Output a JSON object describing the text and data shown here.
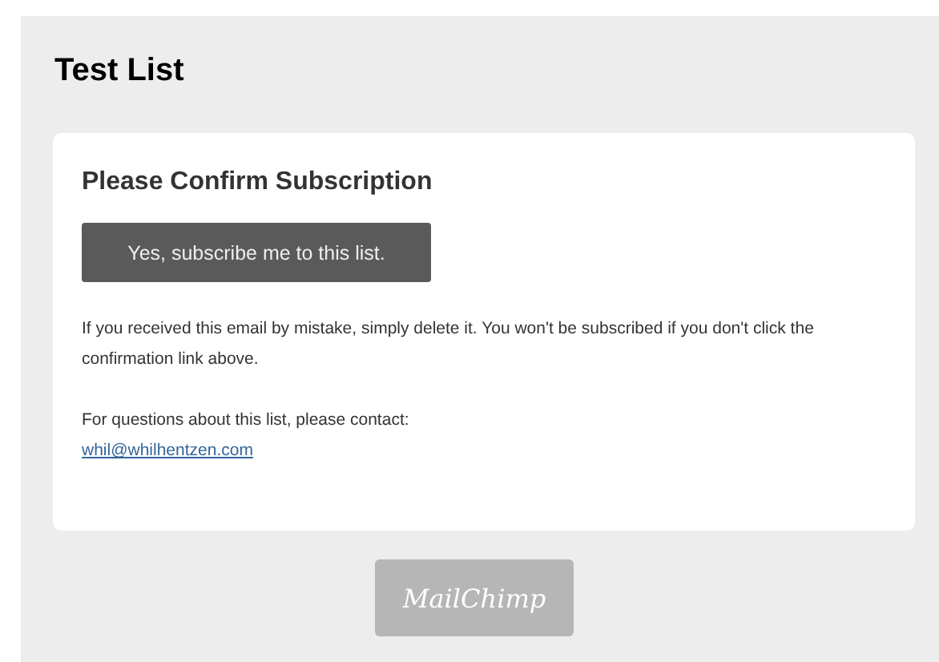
{
  "list_title": "Test List",
  "card": {
    "heading": "Please Confirm Subscription",
    "button": "Yes, subscribe me to this list.",
    "notice": "If you received this email by mistake, simply delete it. You won't be subscribed if you don't click the confirmation link above.",
    "contact_label": "For questions about this list, please contact:",
    "contact_email": "whil@whilhentzen.com"
  },
  "footer_badge": "MailChimp"
}
